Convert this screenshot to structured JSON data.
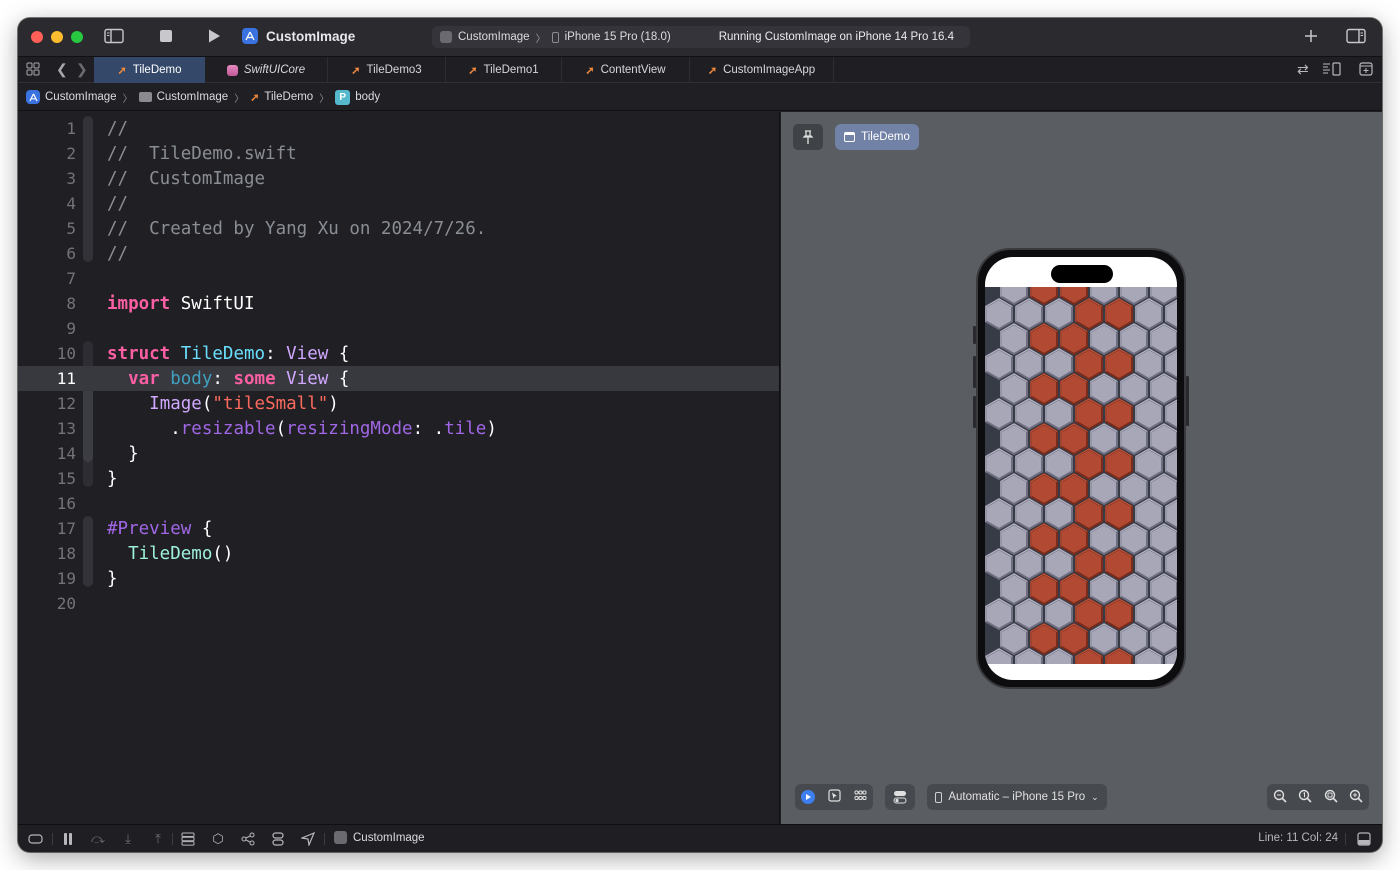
{
  "titlebar": {
    "project_name": "CustomImage",
    "scheme": "CustomImage",
    "destination": "iPhone 15 Pro (18.0)",
    "status": "Running CustomImage on iPhone 14 Pro 16.4"
  },
  "tabs": [
    {
      "label": "TileDemo",
      "icon": "swift-icon",
      "active": true
    },
    {
      "label": "SwiftUICore",
      "icon": "framework-icon",
      "active": false
    },
    {
      "label": "TileDemo3",
      "icon": "swift-icon",
      "active": false
    },
    {
      "label": "TileDemo1",
      "icon": "swift-icon",
      "active": false
    },
    {
      "label": "ContentView",
      "icon": "swift-icon",
      "active": false
    },
    {
      "label": "CustomImageApp",
      "icon": "swift-icon",
      "active": false
    }
  ],
  "breadcrumb": [
    {
      "label": "CustomImage",
      "icon": "app-icon"
    },
    {
      "label": "CustomImage",
      "icon": "folder-icon"
    },
    {
      "label": "TileDemo",
      "icon": "swift-icon"
    },
    {
      "label": "body",
      "icon": "property-icon",
      "badge": "P"
    }
  ],
  "editor": {
    "current_line": 11,
    "lines": [
      {
        "n": "1",
        "tokens": [
          [
            "c",
            "//"
          ]
        ]
      },
      {
        "n": "2",
        "tokens": [
          [
            "c",
            "//  TileDemo.swift"
          ]
        ]
      },
      {
        "n": "3",
        "tokens": [
          [
            "c",
            "//  CustomImage"
          ]
        ]
      },
      {
        "n": "4",
        "tokens": [
          [
            "c",
            "//"
          ]
        ]
      },
      {
        "n": "5",
        "tokens": [
          [
            "c",
            "//  Created by Yang Xu on 2024/7/26."
          ]
        ]
      },
      {
        "n": "6",
        "tokens": [
          [
            "c",
            "//"
          ]
        ]
      },
      {
        "n": "7",
        "tokens": []
      },
      {
        "n": "8",
        "tokens": [
          [
            "k",
            "import"
          ],
          [
            "p",
            " SwiftUI"
          ]
        ]
      },
      {
        "n": "9",
        "tokens": []
      },
      {
        "n": "10",
        "tokens": [
          [
            "k",
            "struct"
          ],
          [
            "p",
            " "
          ],
          [
            "d",
            "TileDemo"
          ],
          [
            "p",
            ": "
          ],
          [
            "t2",
            "View"
          ],
          [
            "p",
            " {"
          ]
        ]
      },
      {
        "n": "11",
        "tokens": [
          [
            "p",
            "  "
          ],
          [
            "k",
            "var"
          ],
          [
            "p",
            " "
          ],
          [
            "v",
            "body"
          ],
          [
            "p",
            ": "
          ],
          [
            "k",
            "some"
          ],
          [
            "p",
            " "
          ],
          [
            "t2",
            "View"
          ],
          [
            "p",
            " {"
          ]
        ]
      },
      {
        "n": "12",
        "tokens": [
          [
            "p",
            "    "
          ],
          [
            "t2",
            "Image"
          ],
          [
            "p",
            "("
          ],
          [
            "s",
            "\"tileSmall\""
          ],
          [
            "p",
            ")"
          ]
        ]
      },
      {
        "n": "13",
        "tokens": [
          [
            "p",
            "      ."
          ],
          [
            "m",
            "resizable"
          ],
          [
            "p",
            "("
          ],
          [
            "m",
            "resizingMode"
          ],
          [
            "p",
            ": ."
          ],
          [
            "m",
            "tile"
          ],
          [
            "p",
            ")"
          ]
        ]
      },
      {
        "n": "14",
        "tokens": [
          [
            "p",
            "  }"
          ]
        ]
      },
      {
        "n": "15",
        "tokens": [
          [
            "p",
            "}"
          ]
        ]
      },
      {
        "n": "16",
        "tokens": []
      },
      {
        "n": "17",
        "tokens": [
          [
            "m",
            "#Preview"
          ],
          [
            "p",
            " {"
          ]
        ]
      },
      {
        "n": "18",
        "tokens": [
          [
            "p",
            "  "
          ],
          [
            "f",
            "TileDemo"
          ],
          [
            "p",
            "()"
          ]
        ]
      },
      {
        "n": "19",
        "tokens": [
          [
            "p",
            "}"
          ]
        ]
      },
      {
        "n": "20",
        "tokens": []
      }
    ]
  },
  "canvas": {
    "preview_name": "TileDemo",
    "device_selector": "Automatic – iPhone 15 Pro",
    "tile_colors": {
      "gray": "#a8a7b8",
      "red": "#b24a33",
      "gap": "#363b45"
    },
    "zoom_buttons": [
      "zoom-out",
      "zoom-actual-size",
      "zoom-to-fit",
      "zoom-in"
    ]
  },
  "statusbar": {
    "scheme": "CustomImage",
    "position": "Line: 11  Col: 24"
  },
  "colors": {
    "accent": "#3a72e0",
    "active_tab": "#34486a",
    "editor_bg": "#1f1f24",
    "canvas_bg": "#5a5e63"
  }
}
